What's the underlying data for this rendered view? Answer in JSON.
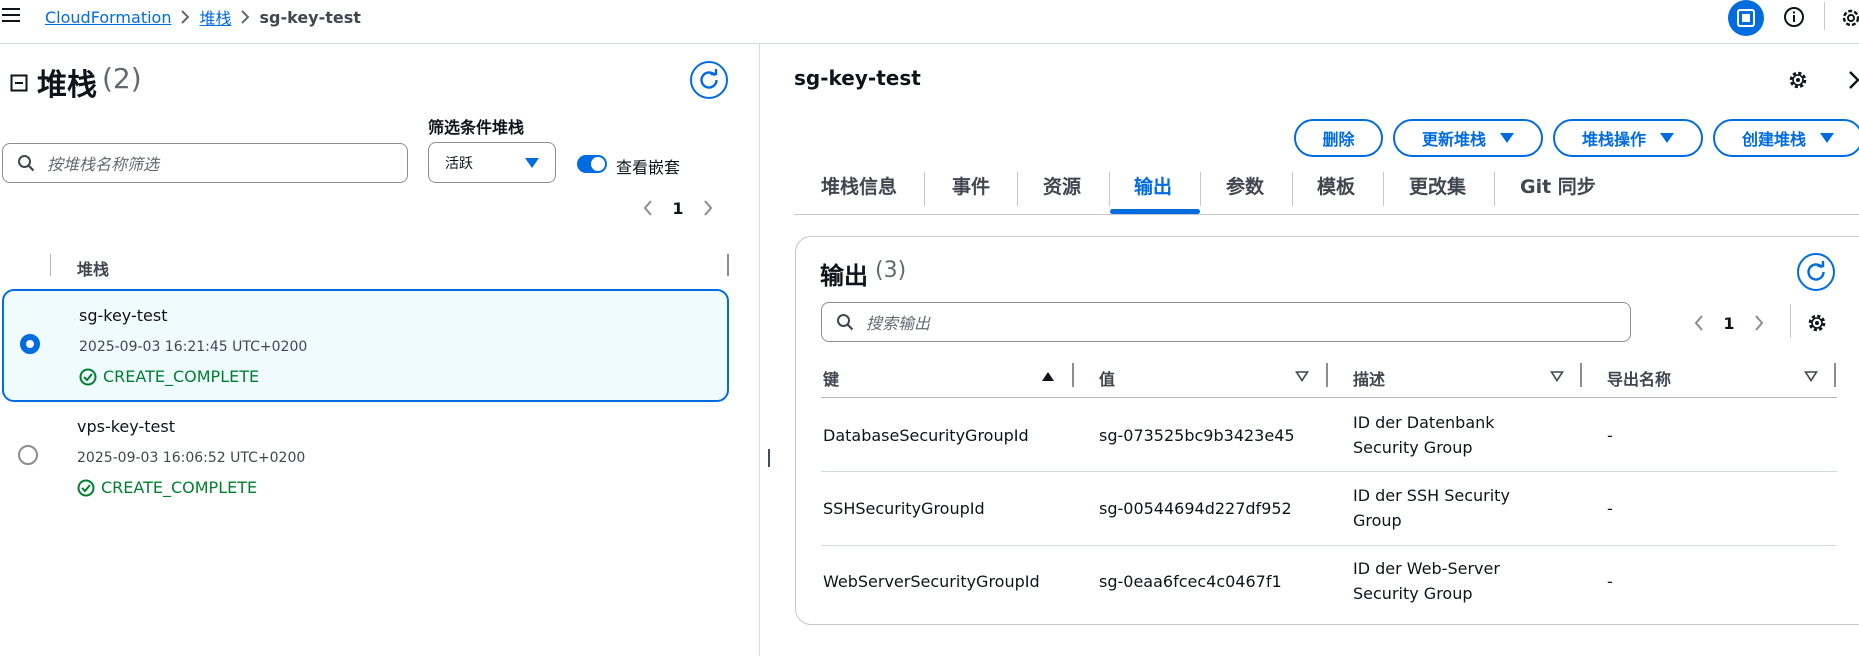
{
  "breadcrumb": {
    "items": [
      "CloudFormation",
      "堆栈"
    ],
    "current": "sg-key-test"
  },
  "left": {
    "title": "堆栈",
    "count": "(2)",
    "filter_label": "筛选条件堆栈",
    "search_placeholder": "按堆栈名称筛选",
    "filter_value": "活跃",
    "toggle_label": "查看嵌套",
    "toggle_on": true,
    "page": "1",
    "column_header": "堆栈",
    "stacks": [
      {
        "name": "sg-key-test",
        "time": "2025-09-03 16:21:45 UTC+0200",
        "status": "CREATE_COMPLETE",
        "selected": true
      },
      {
        "name": "vps-key-test",
        "time": "2025-09-03 16:06:52 UTC+0200",
        "status": "CREATE_COMPLETE",
        "selected": false
      }
    ]
  },
  "detail": {
    "title": "sg-key-test",
    "buttons": {
      "delete": "删除",
      "update": "更新堆栈",
      "actions": "堆栈操作",
      "create": "创建堆栈"
    },
    "tabs": [
      "堆栈信息",
      "事件",
      "资源",
      "输出",
      "参数",
      "模板",
      "更改集",
      "Git 同步"
    ],
    "active_tab": "输出"
  },
  "outputs": {
    "title": "输出",
    "count": "(3)",
    "search_placeholder": "搜索输出",
    "page": "1",
    "columns": [
      "键",
      "值",
      "描述",
      "导出名称"
    ],
    "rows": [
      {
        "key": "DatabaseSecurityGroupId",
        "value": "sg-073525bc9b3423e45",
        "desc1": "ID der Datenbank",
        "desc2": "Security Group",
        "export": "-"
      },
      {
        "key": "SSHSecurityGroupId",
        "value": "sg-00544694d227df952",
        "desc1": "ID der SSH Security",
        "desc2": "Group",
        "export": "-"
      },
      {
        "key": "WebServerSecurityGroupId",
        "value": "sg-0eaa6fcec4c0467f1",
        "desc1": "ID der Web-Server",
        "desc2": "Security Group",
        "export": "-"
      }
    ]
  },
  "colors": {
    "accent": "#006ce0",
    "success": "#00802f",
    "selected_bg": "#f0fbff"
  },
  "icons": [
    "menu-icon",
    "chevron-right-icon",
    "panel-toggle-icon",
    "info-icon",
    "refresh-icon",
    "search-icon",
    "caret-down-icon",
    "check-circle-icon",
    "gear-icon",
    "close-icon",
    "sort-ascending-icon",
    "sort-descending-icon",
    "collapse-icon"
  ]
}
